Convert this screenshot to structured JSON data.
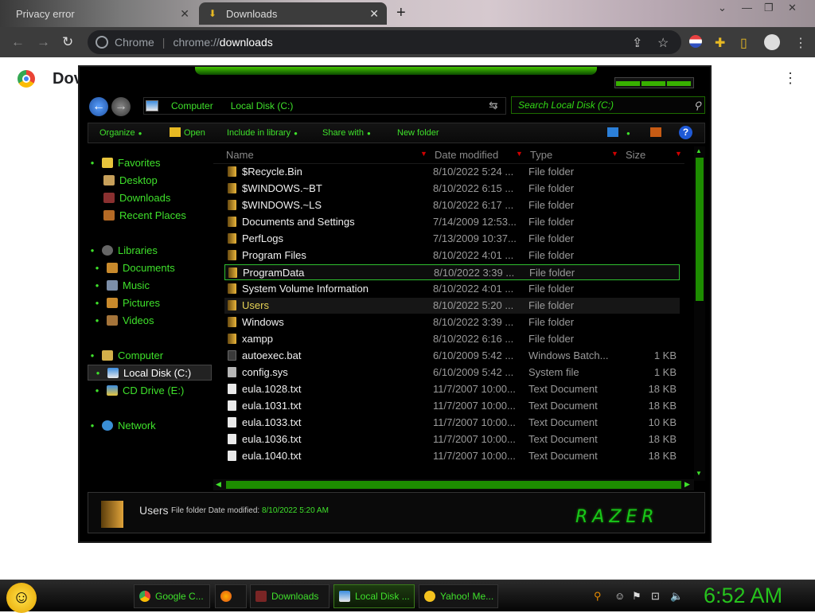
{
  "browser": {
    "tabs": [
      {
        "label": "Privacy error",
        "active": false
      },
      {
        "label": "Downloads",
        "active": true
      }
    ],
    "url_prefix": "Chrome",
    "url_scheme": "chrome://",
    "url_host": "downloads",
    "page_title": "Dov"
  },
  "explorer": {
    "address": [
      "Computer",
      "Local Disk (C:)"
    ],
    "search_placeholder": "Search Local Disk (C:)",
    "toolbar": {
      "organize": "Organize",
      "open": "Open",
      "include": "Include in library",
      "share": "Share with",
      "new_folder": "New folder"
    },
    "nav": {
      "favorites": "Favorites",
      "desktop": "Desktop",
      "downloads": "Downloads",
      "recent": "Recent Places",
      "libraries": "Libraries",
      "documents": "Documents",
      "music": "Music",
      "pictures": "Pictures",
      "videos": "Videos",
      "computer": "Computer",
      "local_disk": "Local Disk (C:)",
      "cd_drive": "CD Drive (E:)",
      "network": "Network"
    },
    "columns": {
      "name": "Name",
      "date": "Date modified",
      "type": "Type",
      "size": "Size"
    },
    "files": [
      {
        "name": "$Recycle.Bin",
        "date": "8/10/2022 5:24 ...",
        "type": "File folder",
        "size": "",
        "kind": "folder"
      },
      {
        "name": "$WINDOWS.~BT",
        "date": "8/10/2022 6:15 ...",
        "type": "File folder",
        "size": "",
        "kind": "folder"
      },
      {
        "name": "$WINDOWS.~LS",
        "date": "8/10/2022 6:17 ...",
        "type": "File folder",
        "size": "",
        "kind": "folder"
      },
      {
        "name": "Documents and Settings",
        "date": "7/14/2009 12:53...",
        "type": "File folder",
        "size": "",
        "kind": "folder"
      },
      {
        "name": "PerfLogs",
        "date": "7/13/2009 10:37...",
        "type": "File folder",
        "size": "",
        "kind": "folder"
      },
      {
        "name": "Program Files",
        "date": "8/10/2022 4:01 ...",
        "type": "File folder",
        "size": "",
        "kind": "folder"
      },
      {
        "name": "ProgramData",
        "date": "8/10/2022 3:39 ...",
        "type": "File folder",
        "size": "",
        "kind": "folder"
      },
      {
        "name": "System Volume Information",
        "date": "8/10/2022 4:01 ...",
        "type": "File folder",
        "size": "",
        "kind": "folder"
      },
      {
        "name": "Users",
        "date": "8/10/2022 5:20 ...",
        "type": "File folder",
        "size": "",
        "kind": "folder"
      },
      {
        "name": "Windows",
        "date": "8/10/2022 3:39 ...",
        "type": "File folder",
        "size": "",
        "kind": "folder"
      },
      {
        "name": "xampp",
        "date": "8/10/2022 6:16 ...",
        "type": "File folder",
        "size": "",
        "kind": "folder"
      },
      {
        "name": "autoexec.bat",
        "date": "6/10/2009 5:42 ...",
        "type": "Windows Batch...",
        "size": "1 KB",
        "kind": "bat"
      },
      {
        "name": "config.sys",
        "date": "6/10/2009 5:42 ...",
        "type": "System file",
        "size": "1 KB",
        "kind": "sys"
      },
      {
        "name": "eula.1028.txt",
        "date": "11/7/2007 10:00...",
        "type": "Text Document",
        "size": "18 KB",
        "kind": "txt"
      },
      {
        "name": "eula.1031.txt",
        "date": "11/7/2007 10:00...",
        "type": "Text Document",
        "size": "18 KB",
        "kind": "txt"
      },
      {
        "name": "eula.1033.txt",
        "date": "11/7/2007 10:00...",
        "type": "Text Document",
        "size": "10 KB",
        "kind": "txt"
      },
      {
        "name": "eula.1036.txt",
        "date": "11/7/2007 10:00...",
        "type": "Text Document",
        "size": "18 KB",
        "kind": "txt"
      },
      {
        "name": "eula.1040.txt",
        "date": "11/7/2007 10:00...",
        "type": "Text Document",
        "size": "18 KB",
        "kind": "txt"
      }
    ],
    "details": {
      "name": "Users",
      "type": "File folder",
      "date_label": "Date modified:",
      "date_value": "8/10/2022 5:20 AM"
    },
    "brand": "RAZER"
  },
  "taskbar": {
    "items": [
      {
        "label": "Google C...",
        "active": false
      },
      {
        "label": "Downloads",
        "active": false
      },
      {
        "label": "Local Disk ...",
        "active": true
      },
      {
        "label": "Yahoo! Me...",
        "active": false
      }
    ],
    "clock": "6:52 AM"
  },
  "colors": {
    "accent_green": "#3fe12b",
    "bg": "#000000"
  }
}
